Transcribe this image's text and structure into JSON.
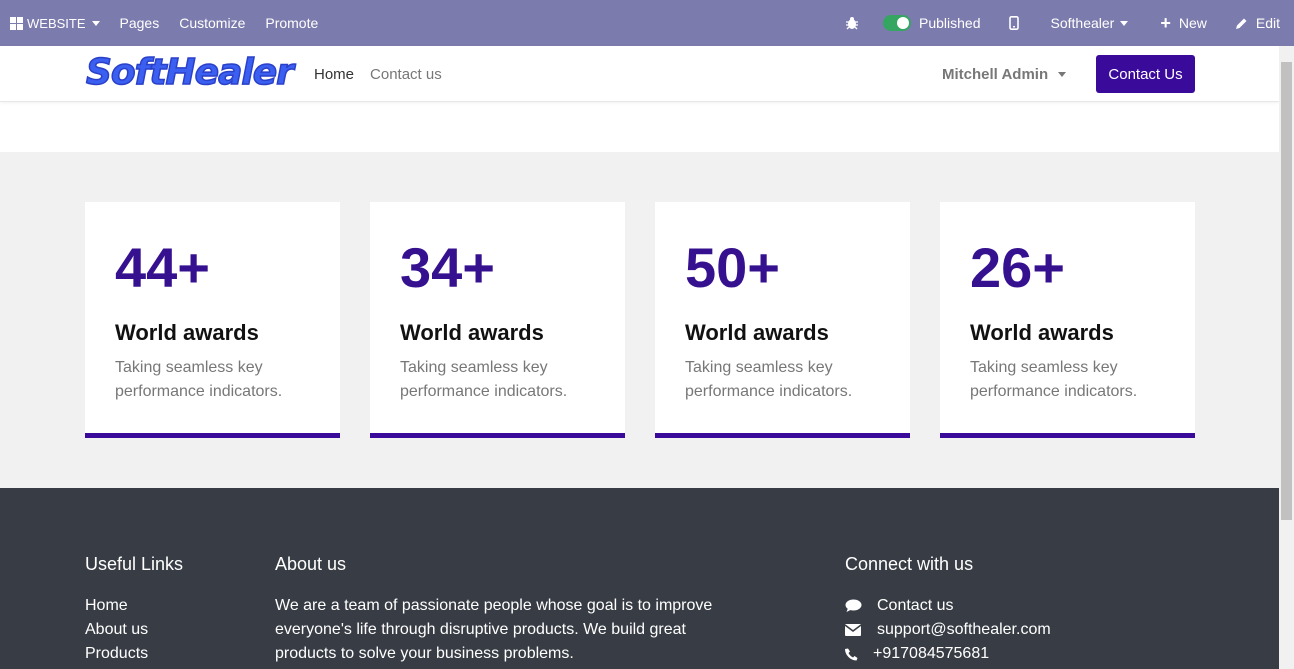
{
  "adminbar": {
    "website_label": "WEBSITE",
    "pages_label": "Pages",
    "customize_label": "Customize",
    "promote_label": "Promote",
    "published_label": "Published",
    "company_label": "Softhealer",
    "new_label": "New",
    "edit_label": "Edit",
    "bg_color": "#7c7bad"
  },
  "header": {
    "logo_text": "SoftHealer",
    "nav": [
      {
        "label": "Home"
      },
      {
        "label": "Contact us"
      }
    ],
    "user_label": "Mitchell Admin",
    "contact_button_label": "Contact Us",
    "accent_color": "#3a0b9b"
  },
  "stats": {
    "cards": [
      {
        "number": "44+",
        "title": "World awards",
        "description": "Taking seamless key performance indicators."
      },
      {
        "number": "34+",
        "title": "World awards",
        "description": "Taking seamless key performance indicators."
      },
      {
        "number": "50+",
        "title": "World awards",
        "description": "Taking seamless key performance indicators."
      },
      {
        "number": "26+",
        "title": "World awards",
        "description": "Taking seamless key performance indicators."
      }
    ]
  },
  "footer": {
    "useful_links": {
      "title": "Useful Links",
      "items": [
        "Home",
        "About us",
        "Products"
      ]
    },
    "about": {
      "title": "About us",
      "text": "We are a team of passionate people whose goal is to improve everyone's life through disruptive products. We build great products to solve your business problems."
    },
    "connect": {
      "title": "Connect with us",
      "items": [
        {
          "icon": "comment-icon",
          "label": "Contact us"
        },
        {
          "icon": "envelope-icon",
          "label": "support@softhealer.com"
        },
        {
          "icon": "phone-icon",
          "label": "+917084575681"
        }
      ]
    }
  }
}
